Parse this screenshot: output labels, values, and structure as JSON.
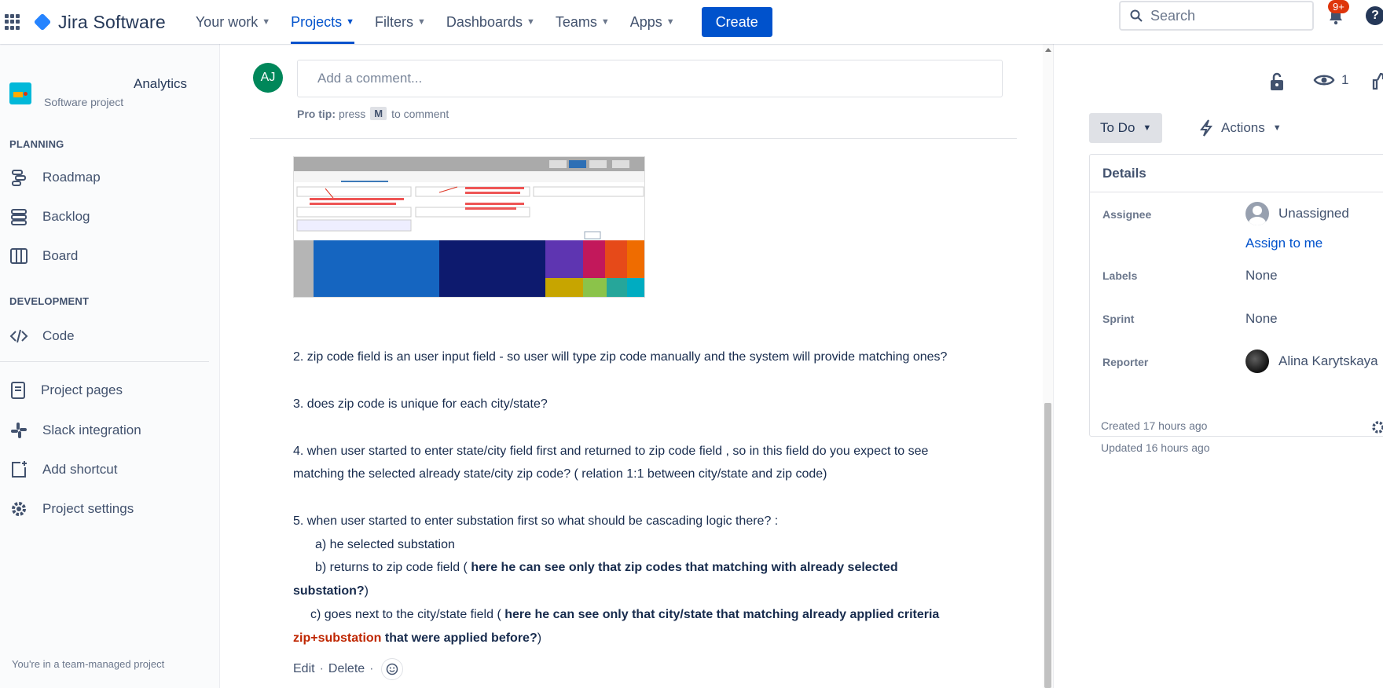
{
  "topnav": {
    "product": "Jira Software",
    "items": [
      {
        "label": "Your work",
        "active": false
      },
      {
        "label": "Projects",
        "active": true
      },
      {
        "label": "Filters",
        "active": false
      },
      {
        "label": "Dashboards",
        "active": false
      },
      {
        "label": "Teams",
        "active": false
      },
      {
        "label": "Apps",
        "active": false
      }
    ],
    "create_label": "Create",
    "search_placeholder": "Search",
    "notifications_badge": "9+",
    "help_label": "?"
  },
  "sidebar": {
    "project_name": "Analytics",
    "project_type": "Software project",
    "planning_heading": "PLANNING",
    "planning_items": [
      "Roadmap",
      "Backlog",
      "Board"
    ],
    "development_heading": "DEVELOPMENT",
    "development_items": [
      "Code"
    ],
    "other_items": [
      "Project pages",
      "Slack integration",
      "Add shortcut",
      "Project settings"
    ],
    "footer": "You're in a team-managed project"
  },
  "comment": {
    "avatar_initials": "AJ",
    "placeholder": "Add a comment...",
    "protip_prefix": "Pro tip:",
    "protip_press": "press",
    "protip_key": "M",
    "protip_suffix": "to comment"
  },
  "questions": {
    "q2": "2. zip code field is an user input field - so user will type zip code manually and the system will provide matching ones?",
    "q3": "3. does zip code is unique for each city/state?",
    "q4_line1": "4. when user started to enter state/city field first and returned to zip code field , so in this field do you expect to see",
    "q4_line2": "matching the selected already state/city zip code? ( relation 1:1 between city/state and zip code)",
    "q5": "5. when user started to enter substation first so what should be cascading logic there? :",
    "q5a": "a) he selected substation",
    "q5b_plain": "b) returns to zip code field ( ",
    "q5b_bold": "here he can see only that zip codes that matching with already selected",
    "q5b_bold2": "substation?",
    "q5b_end": ")",
    "q5c_plain": "c) goes next to the city/state field ( ",
    "q5c_bold": "here he can see only that city/state that matching already applied criteria",
    "q5c_red": "zip+substation",
    "q5c_bold2": " that were applied before?",
    "q5c_end": ")"
  },
  "comment_actions": {
    "edit": "Edit",
    "delete": "Delete",
    "separator": "·"
  },
  "right_panel": {
    "watchers_count": "1",
    "status": "To Do",
    "actions_label": "Actions",
    "details_heading": "Details",
    "assignee_label": "Assignee",
    "assignee_value": "Unassigned",
    "assign_to_me": "Assign to me",
    "labels_label": "Labels",
    "labels_value": "None",
    "sprint_label": "Sprint",
    "sprint_value": "None",
    "reporter_label": "Reporter",
    "reporter_value": "Alina Karytskaya",
    "created": "Created 17 hours ago",
    "updated": "Updated 16 hours ago"
  },
  "colors": {
    "brand": "#0052cc",
    "accent_red": "#bf2600",
    "avatar_green": "#00875a",
    "badge_red": "#de350b"
  }
}
